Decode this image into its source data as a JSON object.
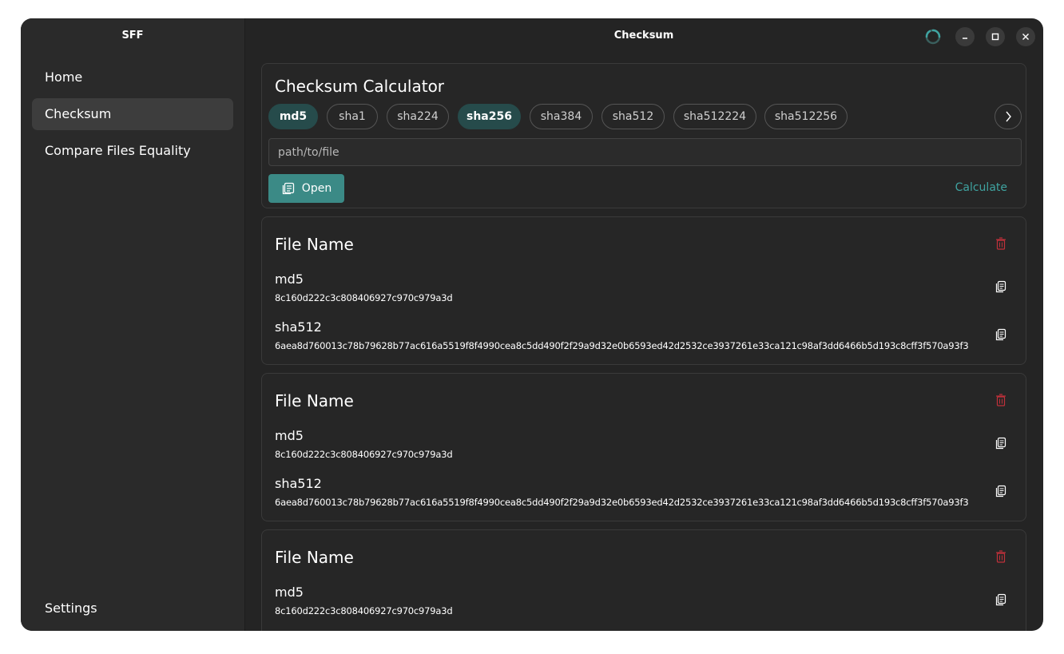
{
  "sidebar": {
    "app_title": "SFF",
    "items": [
      {
        "label": "Home"
      },
      {
        "label": "Checksum"
      },
      {
        "label": "Compare Files Equality"
      }
    ],
    "active_item": "Checksum",
    "settings_label": "Settings"
  },
  "header": {
    "title": "Checksum",
    "icons": [
      "spinner-icon",
      "minimize-icon",
      "maximize-icon",
      "close-icon"
    ]
  },
  "calculator": {
    "title": "Checksum Calculator",
    "algorithms": [
      {
        "label": "md5",
        "selected": true
      },
      {
        "label": "sha1",
        "selected": false
      },
      {
        "label": "sha224",
        "selected": false
      },
      {
        "label": "sha256",
        "selected": true
      },
      {
        "label": "sha384",
        "selected": false
      },
      {
        "label": "sha512",
        "selected": false
      },
      {
        "label": "sha512224",
        "selected": false
      },
      {
        "label": "sha512256",
        "selected": false
      }
    ],
    "path_placeholder": "path/to/file",
    "path_value": "",
    "open_label": "Open",
    "calculate_label": "Calculate"
  },
  "results": [
    {
      "file_name": "File Name",
      "hashes": [
        {
          "algorithm": "md5",
          "value": "8c160d222c3c808406927c970c979a3d"
        },
        {
          "algorithm": "sha512",
          "value": "6aea8d760013c78b79628b77ac616a5519f8f4990cea8c5dd490f2f29a9d32e0b6593ed42d2532ce3937261e33ca121c98af3dd6466b5d193c8cff3f570a93f3"
        }
      ]
    },
    {
      "file_name": "File Name",
      "hashes": [
        {
          "algorithm": "md5",
          "value": "8c160d222c3c808406927c970c979a3d"
        },
        {
          "algorithm": "sha512",
          "value": "6aea8d760013c78b79628b77ac616a5519f8f4990cea8c5dd490f2f29a9d32e0b6593ed42d2532ce3937261e33ca121c98af3dd6466b5d193c8cff3f570a93f3"
        }
      ]
    },
    {
      "file_name": "File Name",
      "hashes": [
        {
          "algorithm": "md5",
          "value": "8c160d222c3c808406927c970c979a3d"
        }
      ]
    }
  ],
  "colors": {
    "accent": "#3b8a86",
    "accent_text": "#3fa3a0",
    "chip_selected": "#264b4b",
    "delete": "#c0313a",
    "background": "#242424"
  }
}
